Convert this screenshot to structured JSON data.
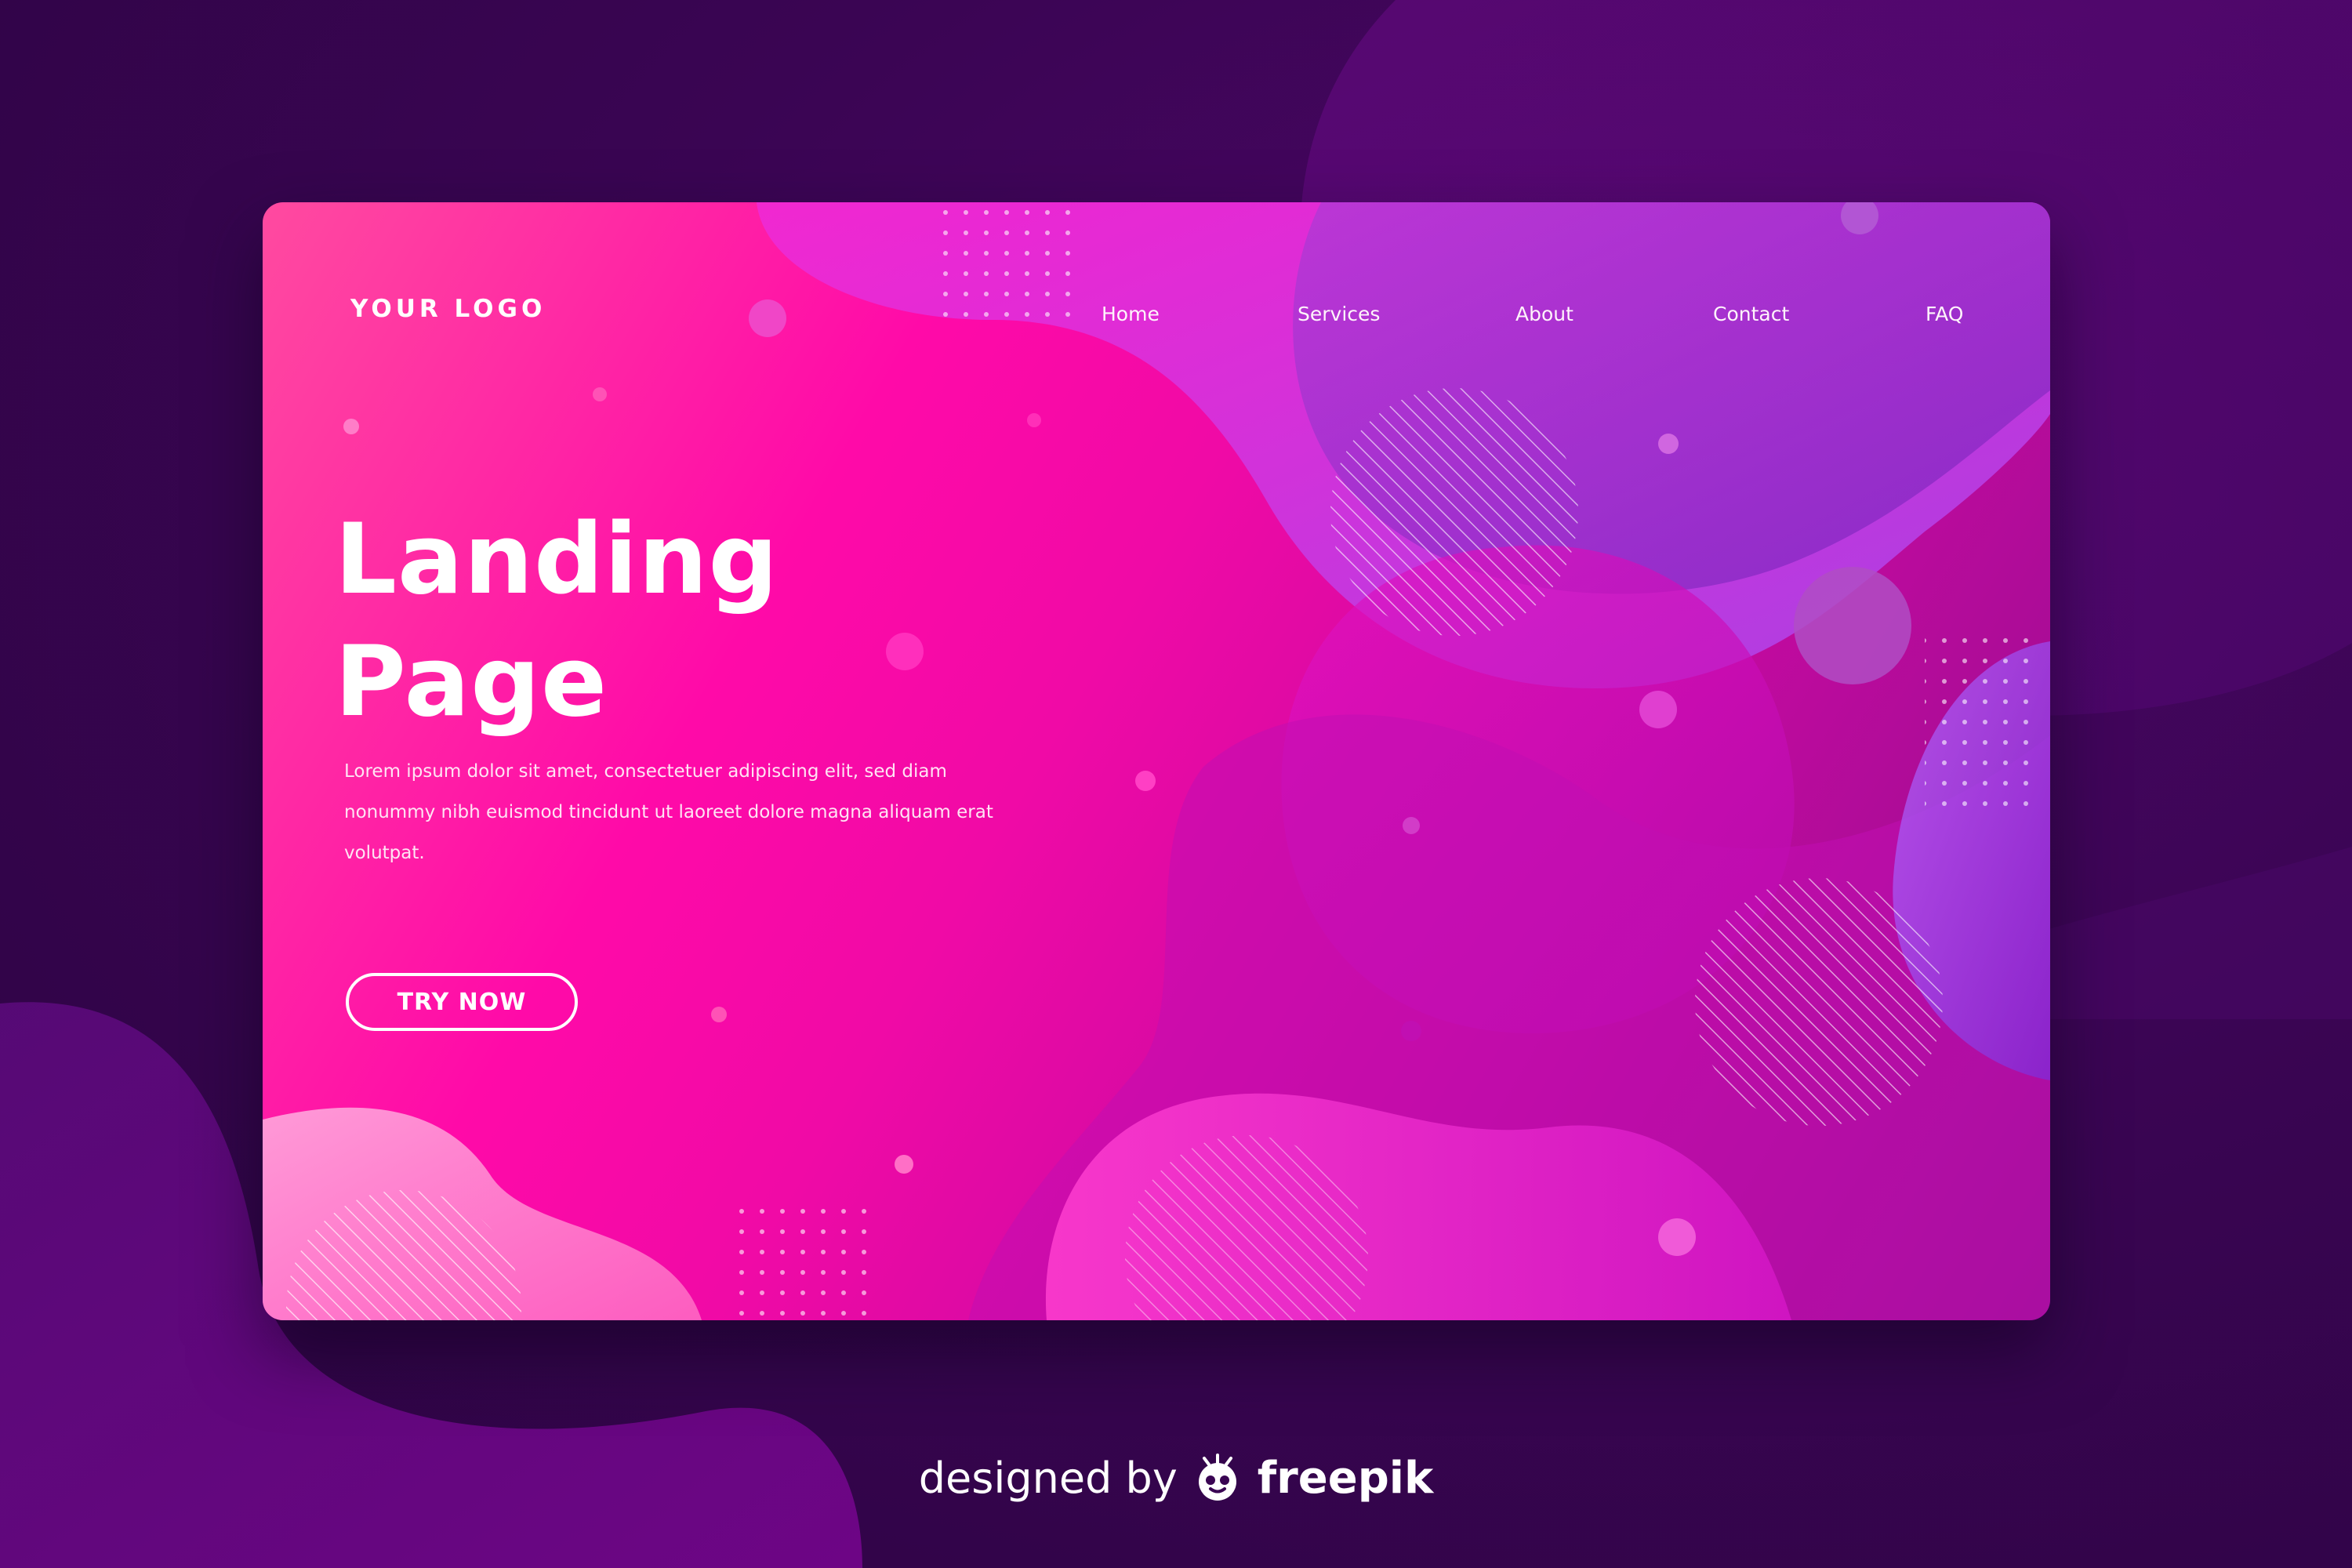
{
  "brand": {
    "logo_text": "YOUR LOGO"
  },
  "nav": {
    "items": [
      {
        "label": "Home"
      },
      {
        "label": "Services"
      },
      {
        "label": "About"
      },
      {
        "label": "Contact"
      },
      {
        "label": "FAQ"
      }
    ]
  },
  "hero": {
    "title_line1": "Landing",
    "title_line2": "Page",
    "body": "Lorem ipsum dolor sit amet, consectetuer adipiscing elit, sed diam nonummy nibh euismod tincidunt ut laoreet dolore magna aliquam erat volutpat.",
    "cta_label": "TRY NOW"
  },
  "credit": {
    "prefix": "designed by",
    "brand": "freepik",
    "icon": "freepik-logo-icon"
  },
  "colors": {
    "background": "#3a0553",
    "card_pink": "#ff0aa8",
    "card_purple": "#8d0f8c",
    "text": "#ffffff"
  }
}
